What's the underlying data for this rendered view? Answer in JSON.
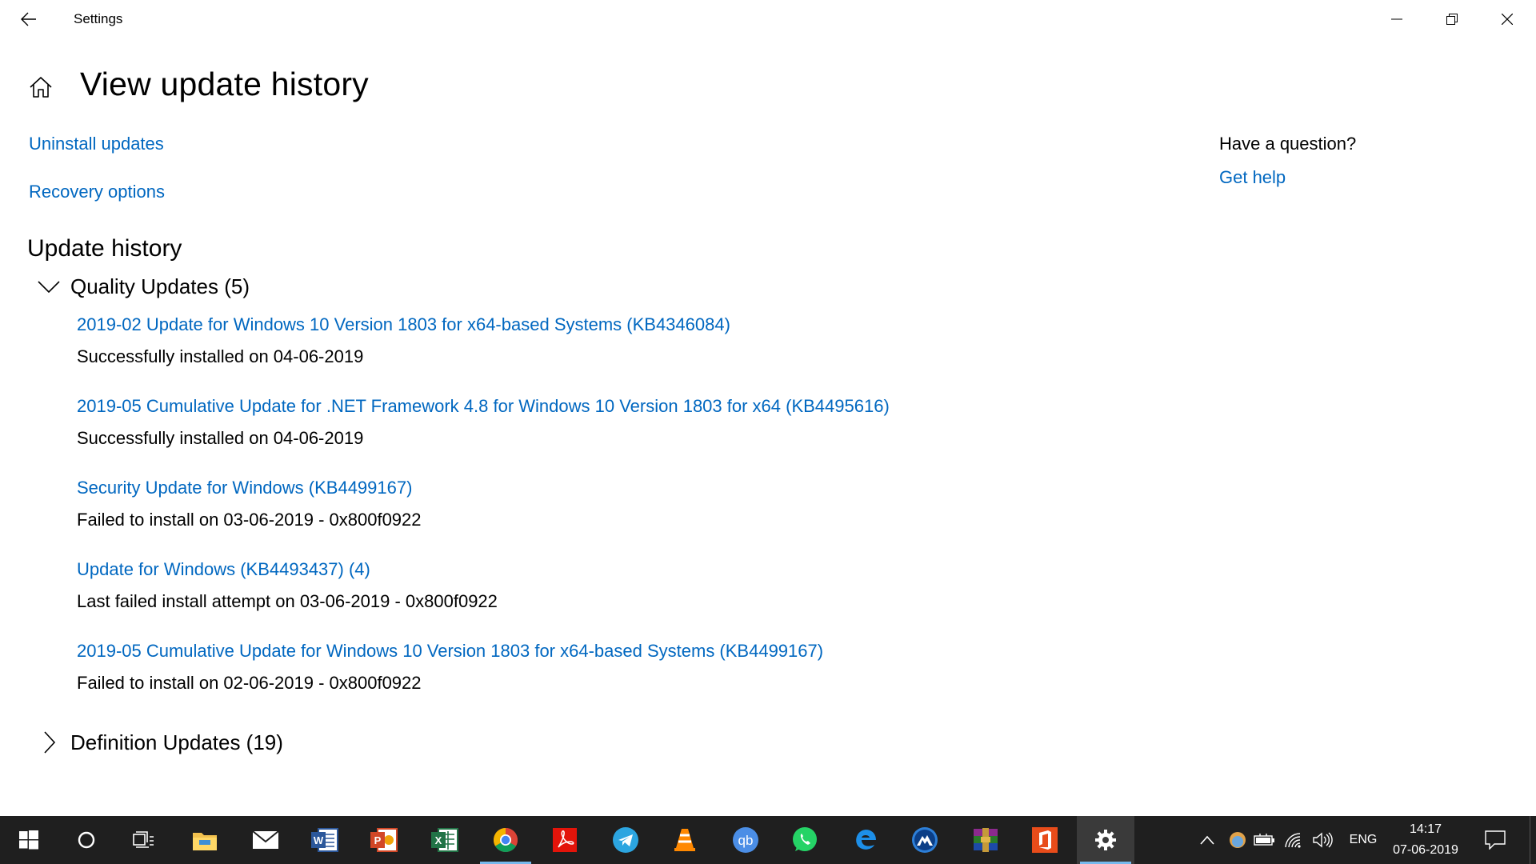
{
  "window": {
    "title": "Settings"
  },
  "page": {
    "title": "View update history"
  },
  "links": {
    "uninstall": "Uninstall updates",
    "recovery": "Recovery options"
  },
  "help": {
    "heading": "Have a question?",
    "link": "Get help"
  },
  "history": {
    "title": "Update history",
    "quality": {
      "label": "Quality Updates (5)",
      "expanded": true,
      "items": [
        {
          "title": "2019-02 Update for Windows 10 Version 1803 for x64-based Systems (KB4346084)",
          "status": "Successfully installed on 04-06-2019"
        },
        {
          "title": "2019-05 Cumulative Update for .NET Framework 4.8 for Windows 10 Version 1803 for x64 (KB4495616)",
          "status": "Successfully installed on 04-06-2019"
        },
        {
          "title": "Security Update for Windows (KB4499167)",
          "status": "Failed to install on 03-06-2019 - 0x800f0922"
        },
        {
          "title": "Update for Windows (KB4493437) (4)",
          "status": "Last failed install attempt on 03-06-2019 - 0x800f0922"
        },
        {
          "title": "2019-05 Cumulative Update for Windows 10 Version 1803 for x64-based Systems (KB4499167)",
          "status": "Failed to install on 02-06-2019 - 0x800f0922"
        }
      ]
    },
    "definition": {
      "label": "Definition Updates (19)",
      "expanded": false
    }
  },
  "taskbar": {
    "apps": [
      "start-icon",
      "cortana-icon",
      "task-view-icon",
      "file-explorer-icon",
      "mail-icon",
      "word-icon",
      "powerpoint-icon",
      "excel-icon",
      "chrome-icon",
      "acrobat-icon",
      "telegram-icon",
      "vlc-icon",
      "qbittorrent-icon",
      "whatsapp-icon",
      "edge-icon",
      "vpn-icon",
      "winrar-icon",
      "office-icon",
      "settings-icon"
    ],
    "active_app": "settings-icon",
    "tray": {
      "language": "ENG",
      "time": "14:17",
      "date": "07-06-2019"
    }
  },
  "colors": {
    "link": "#0067c0",
    "taskbar": "#1f1f1f",
    "active_underline": "#76b9ed"
  }
}
